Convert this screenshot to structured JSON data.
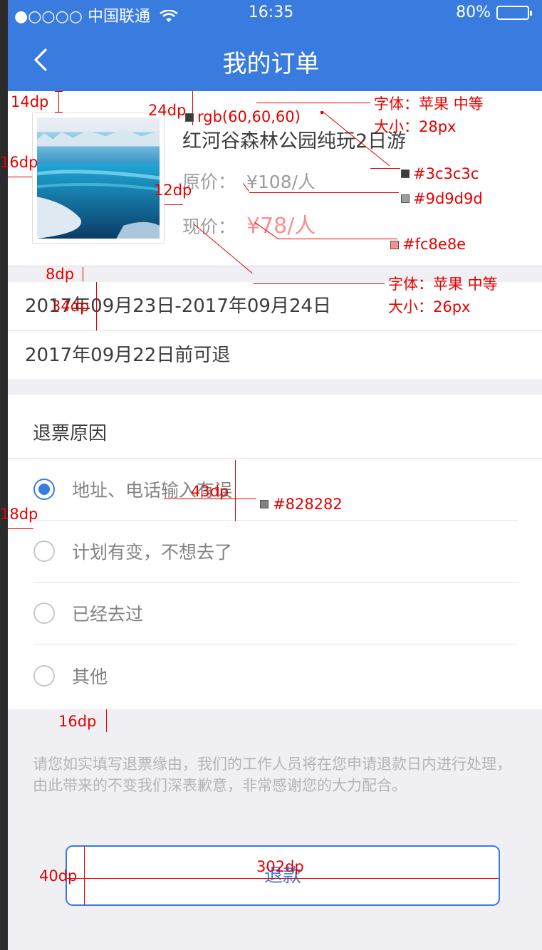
{
  "status": {
    "carrier": "●○○○○ 中国联通",
    "time": "16:35",
    "battery": "80%"
  },
  "nav": {
    "title": "我的订单"
  },
  "product": {
    "name": "红河谷森林公园纯玩2日游",
    "original_label": "原价：",
    "original_price": "¥108/人",
    "current_label": "现价：",
    "current_price": "¥78/人"
  },
  "dates": {
    "range": "2017年09月23日-2017年09月24日",
    "refund_deadline": "2017年09月22日前可退"
  },
  "reasons": {
    "title": "退票原因",
    "selected_index": 0,
    "options": [
      "地址、电话输入有误",
      "计划有变，不想去了",
      "已经去过",
      "其他"
    ]
  },
  "note": "请您如实填写退票缘由，我们的工作人员将在您申请退款日内进行处理，由此带来的不变我们深表歉意，非常感谢您的大力配合。",
  "button": {
    "refund": "退款"
  },
  "annotations": {
    "spacing_14": "14dp",
    "spacing_24": "24dp",
    "spacing_16a": "16dp",
    "spacing_12": "12dp",
    "spacing_8": "8dp",
    "spacing_34": "34dp",
    "spacing_43": "43dp",
    "spacing_18": "18dp",
    "spacing_16b": "16dp",
    "spacing_40": "40dp",
    "spacing_302": "302dp",
    "rgb_note": "rgb(60,60,60)",
    "font1_family": "字体：苹果 中等",
    "font1_size": "大小：28px",
    "color1": "#3c3c3c",
    "color2": "#9d9d9d",
    "color3": "#fc8e8e",
    "font2_family": "字体：苹果 中等",
    "font2_size": "大小：26px",
    "color4": "#828282"
  },
  "colors": {
    "primary": "#3a7be0",
    "text": "#3c3c3c",
    "muted": "#9d9d9d",
    "price": "#fc8e8e",
    "option": "#828282"
  }
}
